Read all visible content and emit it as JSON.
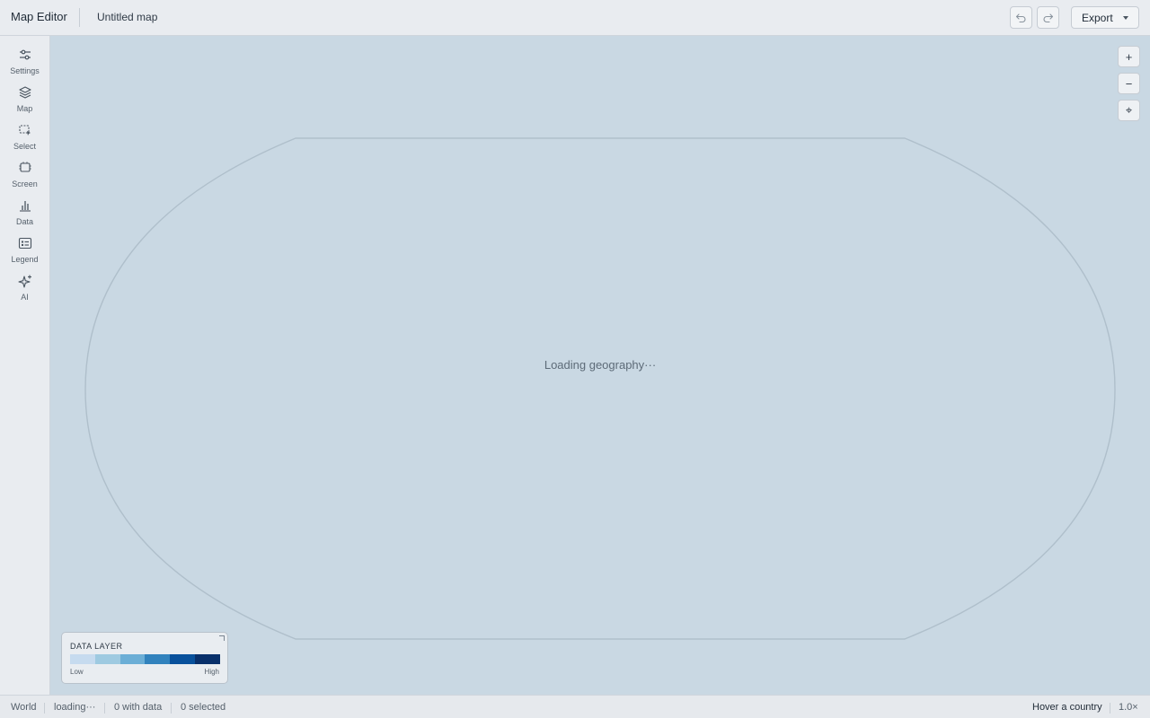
{
  "header": {
    "app_title": "Map Editor",
    "doc_title": "Untitled map",
    "export_label": "Export"
  },
  "sidebar": {
    "items": [
      {
        "label": "Settings",
        "icon": "sliders-icon"
      },
      {
        "label": "Map",
        "icon": "layers-icon"
      },
      {
        "label": "Select",
        "icon": "select-box-icon"
      },
      {
        "label": "Screen",
        "icon": "screen-frame-icon"
      },
      {
        "label": "Data",
        "icon": "bar-chart-icon"
      },
      {
        "label": "Legend",
        "icon": "legend-card-icon"
      },
      {
        "label": "AI",
        "icon": "sparkle-icon"
      }
    ]
  },
  "map": {
    "loading_text": "Loading geography···",
    "zoom_in": "+",
    "zoom_out": "−",
    "locate": "⌖"
  },
  "legend": {
    "title": "DATA LAYER",
    "low_label": "Low",
    "high_label": "High",
    "colors": [
      "#c6dbef",
      "#9ecae1",
      "#6baed6",
      "#3182bd",
      "#08519c",
      "#08306b"
    ]
  },
  "status": {
    "region": "World",
    "loading": "loading···",
    "with_data": "0 with data",
    "selected": "0 selected",
    "hover_hint": "Hover a country",
    "zoom_level": "1.0×"
  }
}
